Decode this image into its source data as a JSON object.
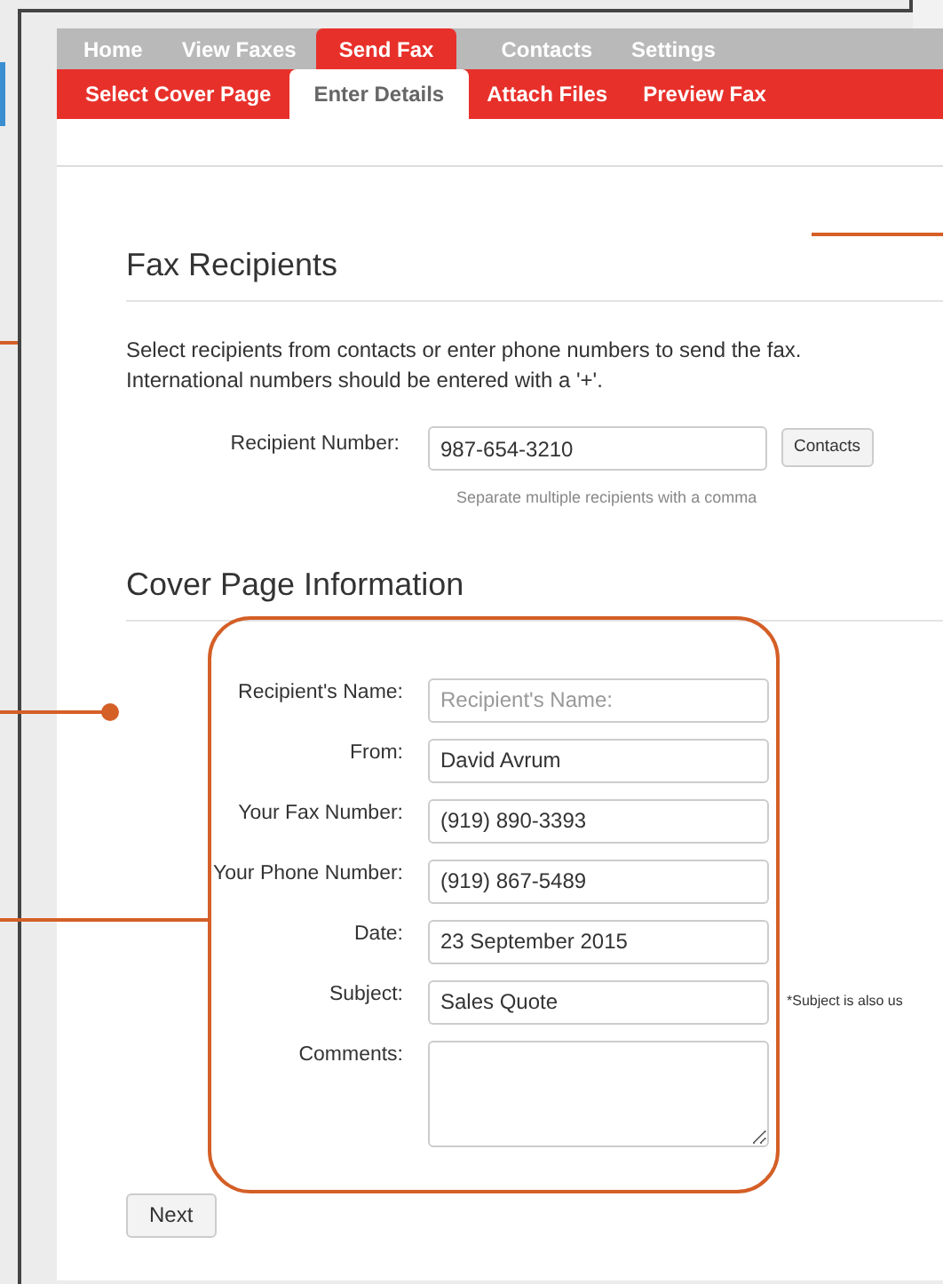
{
  "nav_tabs": [
    {
      "label": "Home",
      "selected": false
    },
    {
      "label": "View Faxes",
      "selected": false
    },
    {
      "label": "Send Fax",
      "selected": true
    },
    {
      "label": "Contacts",
      "selected": false
    },
    {
      "label": "Settings",
      "selected": false
    }
  ],
  "sub_tabs": [
    {
      "label": "Select Cover Page",
      "selected": false
    },
    {
      "label": "Enter Details",
      "selected": true
    },
    {
      "label": "Attach Files",
      "selected": false
    },
    {
      "label": "Preview Fax",
      "selected": false
    }
  ],
  "fax_recipients": {
    "heading": "Fax Recipients",
    "description": "Select recipients from contacts or enter phone numbers to send the fax. International numbers should be entered with a '+'.",
    "label": "Recipient Number:",
    "value": "987-654-3210",
    "button": "Contacts",
    "help": "Separate multiple recipients with a comma"
  },
  "cover_page": {
    "heading": "Cover Page Information",
    "fields": [
      {
        "kind": "text",
        "label": "Recipient's Name:",
        "placeholder": "Recipient's Name:"
      },
      {
        "kind": "text",
        "label": "From:",
        "value": "David Avrum"
      },
      {
        "kind": "text",
        "label": "Your Fax Number:",
        "value": "(919) 890-3393"
      },
      {
        "kind": "text",
        "label": "Your Phone Number:",
        "value": "(919) 867-5489"
      },
      {
        "kind": "text",
        "label": "Date:",
        "value": "23 September 2015"
      },
      {
        "kind": "text",
        "label": "Subject:",
        "value": "Sales Quote",
        "note": "*Subject is also us"
      },
      {
        "kind": "textarea",
        "label": "Comments:"
      }
    ]
  },
  "next_button": "Next"
}
